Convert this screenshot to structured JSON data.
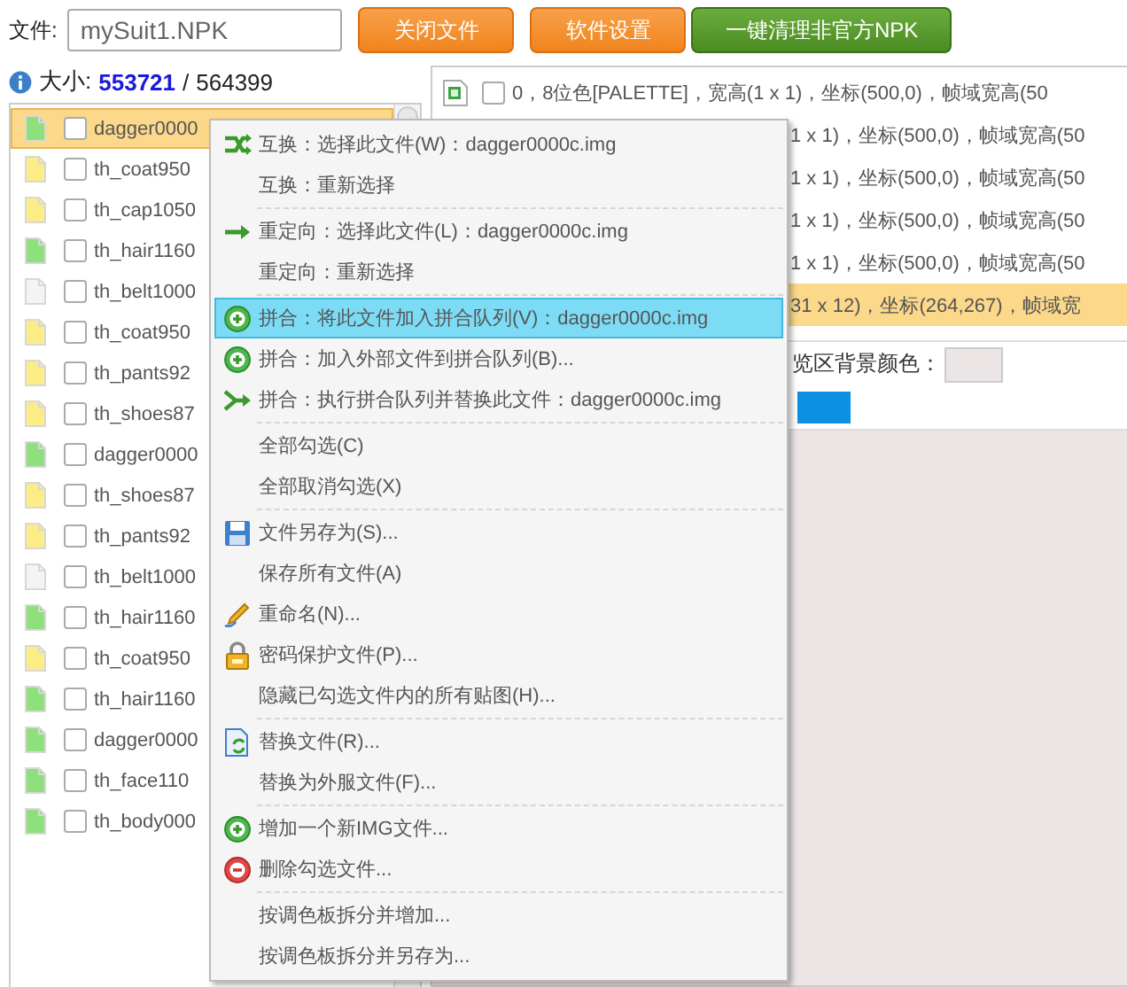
{
  "file_field": {
    "label": "文件:",
    "value": "mySuit1.NPK"
  },
  "buttons": [
    {
      "label": "关闭文件",
      "kind": "orange"
    },
    {
      "label": "软件设置",
      "kind": "orange"
    },
    {
      "label": "一键清理非官方NPK",
      "kind": "green"
    }
  ],
  "size": {
    "label": "大小:",
    "used": "553721",
    "separator": "/",
    "total": "564399"
  },
  "file_list": [
    {
      "name": "dagger0000",
      "color": "#8ee07c",
      "checked": false,
      "selected": true
    },
    {
      "name": "th_coat950",
      "color": "#fbec86",
      "checked": false,
      "selected": false
    },
    {
      "name": "th_cap1050",
      "color": "#fbec86",
      "checked": false,
      "selected": false
    },
    {
      "name": "th_hair1160",
      "color": "#8ee07c",
      "checked": false,
      "selected": false
    },
    {
      "name": "th_belt1000",
      "color": "#f4f4f4",
      "checked": false,
      "selected": false
    },
    {
      "name": "th_coat950",
      "color": "#fbec86",
      "checked": false,
      "selected": false
    },
    {
      "name": "th_pants92",
      "color": "#fbec86",
      "checked": false,
      "selected": false
    },
    {
      "name": "th_shoes87",
      "color": "#fbec86",
      "checked": false,
      "selected": false
    },
    {
      "name": "dagger0000",
      "color": "#8ee07c",
      "checked": false,
      "selected": false
    },
    {
      "name": "th_shoes87",
      "color": "#fbec86",
      "checked": false,
      "selected": false
    },
    {
      "name": "th_pants92",
      "color": "#fbec86",
      "checked": false,
      "selected": false
    },
    {
      "name": "th_belt1000",
      "color": "#f4f4f4",
      "checked": false,
      "selected": false
    },
    {
      "name": "th_hair1160",
      "color": "#8ee07c",
      "checked": false,
      "selected": false
    },
    {
      "name": "th_coat950",
      "color": "#fbec86",
      "checked": false,
      "selected": false
    },
    {
      "name": "th_hair1160",
      "color": "#8ee07c",
      "checked": false,
      "selected": false
    },
    {
      "name": "dagger0000",
      "color": "#8ee07c",
      "checked": false,
      "selected": false
    },
    {
      "name": "th_face110",
      "color": "#8ee07c",
      "checked": false,
      "selected": false
    },
    {
      "name": "th_body000",
      "color": "#8ee07c",
      "checked": false,
      "selected": false
    }
  ],
  "entries": [
    {
      "kind": "full",
      "text": "0，8位色[PALETTE]，宽高(1 x 1)，坐标(500,0)，帧域宽高(50",
      "checked": false,
      "selected": false
    },
    {
      "kind": "covered",
      "text": "1 x 1)，坐标(500,0)，帧域宽高(50",
      "selected": false
    },
    {
      "kind": "covered",
      "text": "1 x 1)，坐标(500,0)，帧域宽高(50",
      "selected": false
    },
    {
      "kind": "covered",
      "text": "1 x 1)，坐标(500,0)，帧域宽高(50",
      "selected": false
    },
    {
      "kind": "covered",
      "text": "1 x 1)，坐标(500,0)，帧域宽高(50",
      "selected": false
    },
    {
      "kind": "covered",
      "text": "31 x 12)，坐标(264,267)，帧域宽",
      "selected": true
    }
  ],
  "preview": {
    "bg_label": "览区背景颜色："
  },
  "context_menu": [
    [
      {
        "label": "互换：选择此文件(W)：dagger0000c.img",
        "kind": "swap",
        "selected": false
      },
      {
        "label": "互换：重新选择",
        "kind": "plain",
        "selected": false
      }
    ],
    [
      {
        "label": "重定向：选择此文件(L)：dagger0000c.img",
        "kind": "arrow",
        "selected": false
      },
      {
        "label": "重定向：重新选择",
        "kind": "plain",
        "selected": false
      }
    ],
    [
      {
        "label": "拼合：将此文件加入拼合队列(V)：dagger0000c.img",
        "kind": "plus",
        "selected": true
      },
      {
        "label": "拼合：加入外部文件到拼合队列(B)...",
        "kind": "plus",
        "selected": false
      },
      {
        "label": "拼合：执行拼合队列并替换此文件：dagger0000c.img",
        "kind": "merge",
        "selected": false
      }
    ],
    [
      {
        "label": "全部勾选(C)",
        "kind": "plain",
        "selected": false
      },
      {
        "label": "全部取消勾选(X)",
        "kind": "plain",
        "selected": false
      }
    ],
    [
      {
        "label": "文件另存为(S)...",
        "kind": "floppy",
        "selected": false
      },
      {
        "label": "保存所有文件(A)",
        "kind": "plain",
        "selected": false
      },
      {
        "label": "重命名(N)...",
        "kind": "pencil",
        "selected": false
      },
      {
        "label": "密码保护文件(P)...",
        "kind": "lock",
        "selected": false
      },
      {
        "label": "隐藏已勾选文件内的所有贴图(H)...",
        "kind": "plain",
        "selected": false
      }
    ],
    [
      {
        "label": "替换文件(R)...",
        "kind": "replace",
        "selected": false
      },
      {
        "label": "替换为外服文件(F)...",
        "kind": "plain",
        "selected": false
      }
    ],
    [
      {
        "label": "增加一个新IMG文件...",
        "kind": "plus",
        "selected": false
      },
      {
        "label": "删除勾选文件...",
        "kind": "minus",
        "selected": false
      }
    ],
    [
      {
        "label": "按调色板拆分并增加...",
        "kind": "plain",
        "selected": false
      },
      {
        "label": "按调色板拆分并另存为...",
        "kind": "plain",
        "selected": false
      }
    ]
  ]
}
